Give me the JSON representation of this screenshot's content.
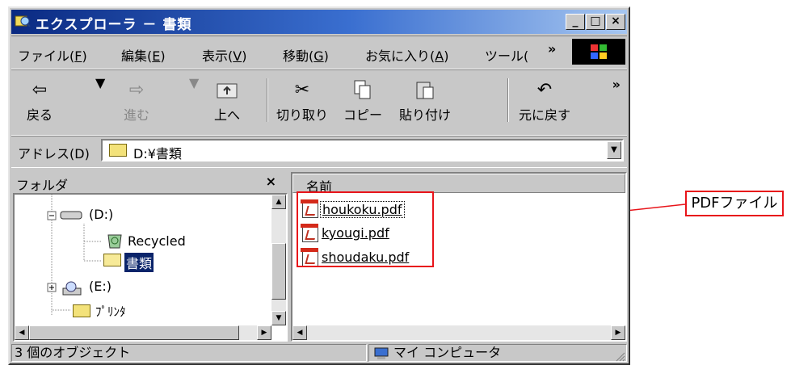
{
  "window": {
    "title": "エクスプローラ － 書類",
    "buttons": [
      "_",
      "□",
      "×"
    ]
  },
  "menu": {
    "items": [
      {
        "label": "ファイル(",
        "key": "F",
        "suffix": ")"
      },
      {
        "label": "編集(",
        "key": "E",
        "suffix": ")"
      },
      {
        "label": "表示(",
        "key": "V",
        "suffix": ")"
      },
      {
        "label": "移動(",
        "key": "G",
        "suffix": ")"
      },
      {
        "label": "お気に入り(",
        "key": "A",
        "suffix": ")"
      },
      {
        "label": "ツール(",
        "key": "",
        "suffix": ""
      }
    ],
    "overflow": "»"
  },
  "toolbar": {
    "back": "戻る",
    "forward": "進む",
    "up": "上へ",
    "cut": "切り取り",
    "copy": "コピー",
    "paste": "貼り付け",
    "undo": "元に戻す",
    "overflow": "»"
  },
  "address": {
    "label": "アドレス(D)",
    "value": "D:¥書類"
  },
  "folders": {
    "header": "フォルダ",
    "close": "×",
    "items": [
      "(D:)",
      "Recycled",
      "書類",
      "(E:)",
      "ﾌﾟﾘﾝﾀ"
    ]
  },
  "files": {
    "column_header": "名前",
    "items": [
      "houkoku.pdf",
      "kyougi.pdf",
      "shoudaku.pdf"
    ]
  },
  "status": {
    "objects": "3 個のオブジェクト",
    "location": "マイ コンピュータ"
  },
  "callout": {
    "label": "PDFファイル"
  },
  "colors": {
    "highlight": "#e8141a",
    "selection": "#0a246a",
    "title_start": "#0a2a82"
  }
}
